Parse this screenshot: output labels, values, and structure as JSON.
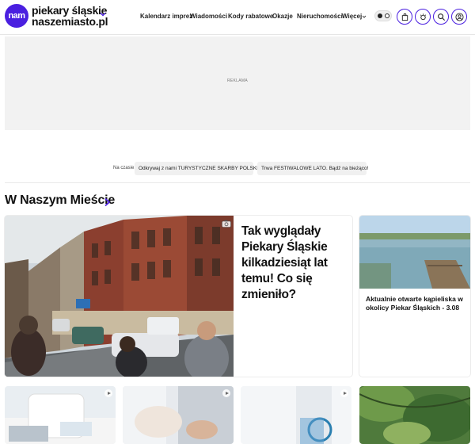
{
  "header": {
    "logo_badge": "nam",
    "logo_line1": "piekary śląskie",
    "logo_line2": "naszemiasto.pl",
    "nav": [
      "Kalendarz imprez",
      "Wiadomości",
      "Kody rabatowe",
      "Okazje",
      "Nieruchomości",
      "Więcej"
    ],
    "icons": [
      "chevron-down-icon",
      "theme-toggle-icon",
      "bag-icon",
      "weather-icon",
      "search-icon",
      "user-icon"
    ],
    "accent": "#4a1fe0"
  },
  "ad": {
    "label": "REKLAMA"
  },
  "trending": {
    "label": "Na czasie:",
    "items": [
      "Odkrywaj z nami TURYSTYCZNE SKARBY POLSKI",
      "Trwa FESTIWALOWE LATO. Bądź na bieżąco!"
    ]
  },
  "section": {
    "title": "W Naszym Mieście",
    "feature": {
      "title": "Tak wyglądały Piekary Śląskie kilkadziesiąt lat temu! Co się zmieniło?"
    },
    "side": {
      "title": "Aktualnie otwarte kąpieliska w okolicy Piekar Śląskich - 3.08"
    }
  }
}
